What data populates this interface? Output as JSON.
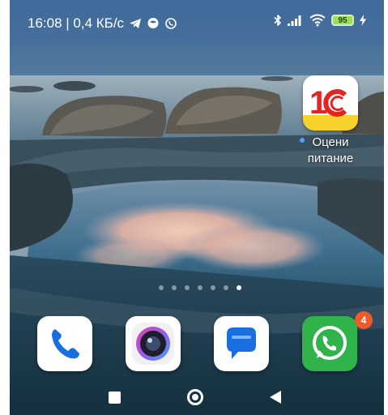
{
  "status_bar": {
    "time_speed": "16:08 | 0,4 КБ/с",
    "battery_level": "95",
    "icons": [
      "telegram-icon",
      "chat-bubble-icon",
      "whatsapp-small-icon",
      "bluetooth-icon",
      "signal-icon",
      "wifi-icon",
      "battery-icon",
      "charging-icon"
    ]
  },
  "home": {
    "apps": [
      {
        "name": "1С",
        "icon": "1c-logo-icon",
        "label_line1": "Оцени",
        "label_line2": "питание",
        "new_dot_color": "#4aa3ff"
      }
    ],
    "pages": {
      "count": 7,
      "current": 7
    }
  },
  "dock": {
    "apps": [
      {
        "icon": "phone-icon"
      },
      {
        "icon": "camera-icon"
      },
      {
        "icon": "messages-icon"
      },
      {
        "icon": "whatsapp-icon",
        "badge": "4"
      }
    ]
  },
  "nav": {
    "buttons": [
      "recents-button",
      "home-button",
      "back-button"
    ]
  },
  "colors": {
    "status_bar": "#426c9b",
    "badge": "#f05a28",
    "whatsapp": "#2fb34a",
    "brand_1c": "#e52421"
  }
}
